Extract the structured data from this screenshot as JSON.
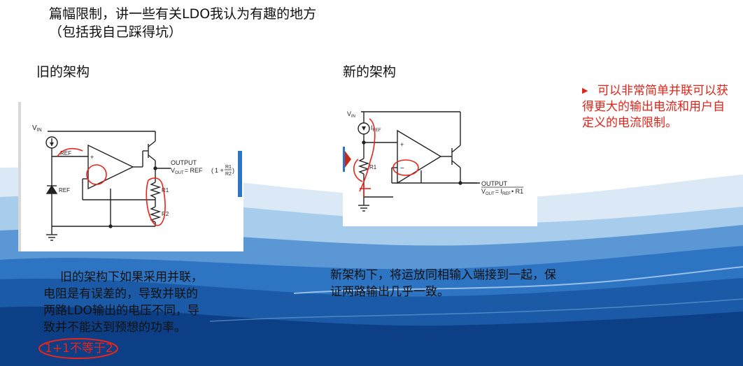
{
  "header": {
    "line1": "篇幅限制，讲一些有关LDO我认为有趣的地方",
    "line2": "（包括我自己踩得坑）"
  },
  "left": {
    "title": "旧的架构",
    "diagram": {
      "vin": "V",
      "vin_sub": "IN",
      "ref_source": "REF",
      "ref_diode": "REF",
      "plus": "+",
      "output": "OUTPUT",
      "formula_v": "V",
      "formula_sub": "OUT",
      "formula_eq": "= REF",
      "formula_one_plus": "1 +",
      "formula_num": "R1",
      "formula_den": "R2",
      "r1": "R1",
      "r2": "R2"
    },
    "paragraph": [
      "旧的架构下如果采用并联，",
      "电阻是有误差的，导致并联的",
      "两路LDO输出的电压不同，导",
      "致并不能达到预想的功率。"
    ],
    "handwritten_note": "1+1不等于2"
  },
  "right": {
    "title": "新的架构",
    "diagram": {
      "vin": "V",
      "vin_sub": "IN",
      "iref": "I",
      "iref_sub": "REF",
      "plus": "+",
      "minus": "−",
      "r1": "R1",
      "output": "OUTPUT",
      "formula_v": "V",
      "formula_sub": "OUT",
      "formula_eq": "= I",
      "formula_isub": "REF",
      "formula_tail": "• R1"
    },
    "paragraph": [
      "新架构下，将运放同相输入端接到一起，保",
      "证两路输出几乎一致。"
    ]
  },
  "side_note": {
    "text": "可以非常简单并联可以获得更大的输出电流和用户自定义的电流限制。",
    "color": "#e0241a"
  },
  "colors": {
    "wave_dark": "#0d3f86",
    "wave_mid": "#2d74c2",
    "wave_light": "#9fc7ea",
    "accent_red": "#e8241b"
  }
}
